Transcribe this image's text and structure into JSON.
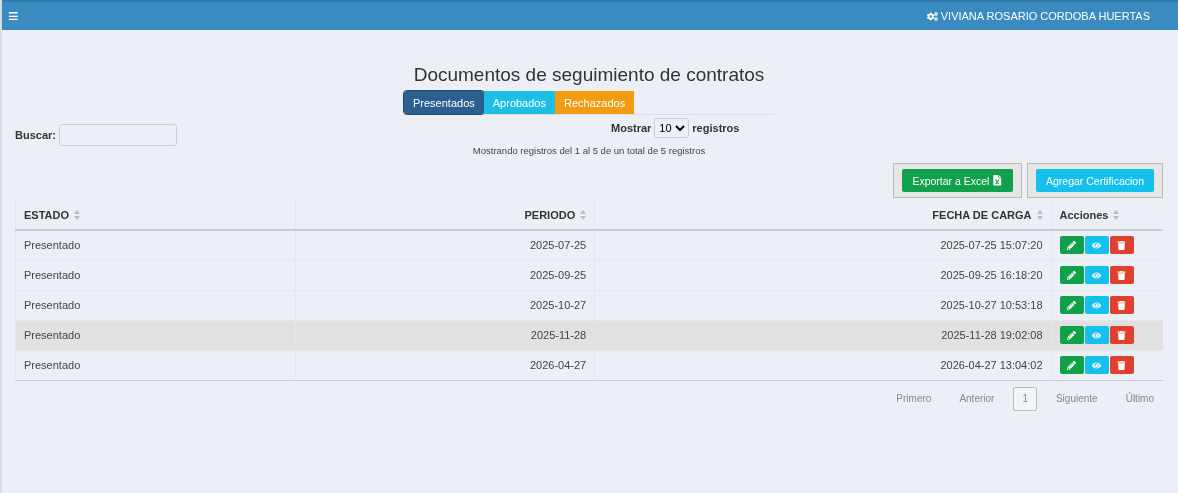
{
  "topbar": {
    "menu_icon": "≡",
    "user": "VIVIANA ROSARIO CORDOBA HUERTAS"
  },
  "title": "Documentos de seguimiento de contratos",
  "tabs": [
    {
      "label": "Presentados",
      "selected": true,
      "color": "#2a5f8f"
    },
    {
      "label": "Aprobados",
      "selected": false,
      "color": "#1ebfe6"
    },
    {
      "label": "Rechazados",
      "selected": false,
      "color": "#f39c12"
    }
  ],
  "search": {
    "label": "Buscar:"
  },
  "length": {
    "before": "Mostrar",
    "value": "10",
    "after": "registros"
  },
  "info": "Mostrando registros del 1 al 5 de un total de 5 registros",
  "buttons": [
    {
      "label": "Exportar a Excel",
      "kind": "excel"
    },
    {
      "label": "Agregar Certificacion",
      "kind": "add"
    }
  ],
  "table": {
    "columns": [
      "ESTADO",
      "PERIODO",
      "FECHA DE CARGA",
      "Acciones"
    ],
    "rows": [
      {
        "estado": "Presentado",
        "periodo": "2025-07-25",
        "fecha": "2025-07-25 15:07:20",
        "selected": false
      },
      {
        "estado": "Presentado",
        "periodo": "2025-09-25",
        "fecha": "2025-09-25 16:18:20",
        "selected": false
      },
      {
        "estado": "Presentado",
        "periodo": "2025-10-27",
        "fecha": "2025-10-27 10:53:18",
        "selected": false
      },
      {
        "estado": "Presentado",
        "periodo": "2025-11-28",
        "fecha": "2025-11-28 19:02:08",
        "selected": true
      },
      {
        "estado": "Presentado",
        "periodo": "2026-04-27",
        "fecha": "2026-04-27 13:04:02",
        "selected": false
      }
    ]
  },
  "pagination": [
    {
      "label": "Primero",
      "selected": false
    },
    {
      "label": "Anterior",
      "selected": false
    },
    {
      "label": "1",
      "selected": true
    },
    {
      "label": "Siguiente",
      "selected": false
    },
    {
      "label": "Último",
      "selected": false
    }
  ]
}
